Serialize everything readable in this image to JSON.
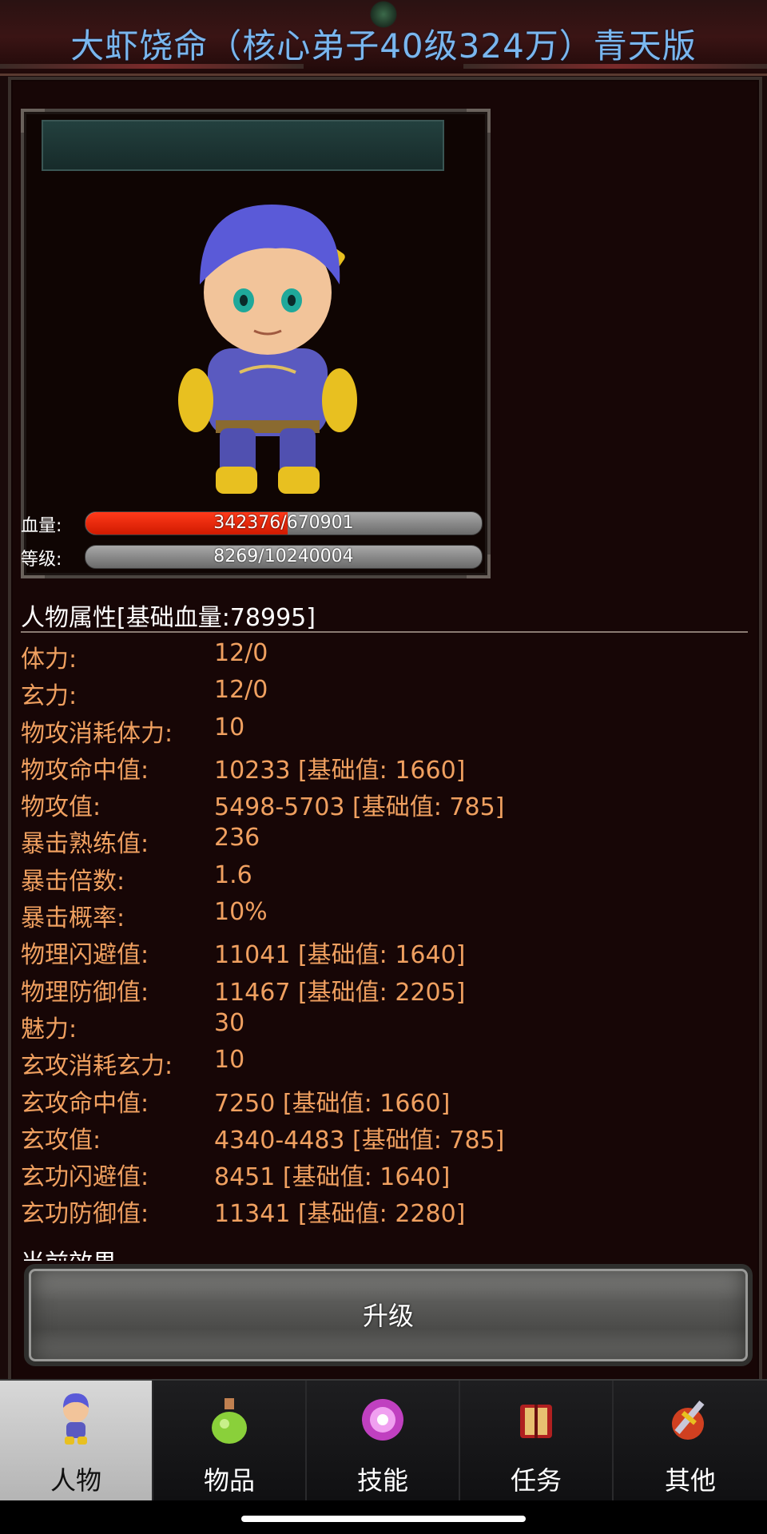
{
  "header": {
    "title": "大虾饶命（核心弟子40级324万）青天版"
  },
  "stats": {
    "hp": {
      "label": "血量:",
      "current": 342376,
      "max": 670901,
      "text": "342376/670901",
      "color": "#e8240a"
    },
    "level": {
      "label": "等级:",
      "current": 8269,
      "max": 10240004,
      "text": "8269/10240004"
    }
  },
  "attributes": {
    "title": "人物属性[基础血量:78995]",
    "rows": [
      {
        "label": "体力:",
        "value": "12/0"
      },
      {
        "label": "玄力:",
        "value": "12/0"
      },
      {
        "label": "物攻消耗体力:",
        "value": "10"
      },
      {
        "label": "物攻命中值:",
        "value": "10233 [基础值: 1660]"
      },
      {
        "label": "物攻值:",
        "value": "5498-5703 [基础值: 785]"
      },
      {
        "label": "暴击熟练值:",
        "value": "236"
      },
      {
        "label": "暴击倍数:",
        "value": "1.6"
      },
      {
        "label": "暴击概率:",
        "value": "10%"
      },
      {
        "label": "物理闪避值:",
        "value": "11041 [基础值: 1640]"
      },
      {
        "label": "物理防御值:",
        "value": "11467 [基础值: 2205]"
      },
      {
        "label": "魅力:",
        "value": "30"
      },
      {
        "label": "玄攻消耗玄力:",
        "value": "10"
      },
      {
        "label": "玄攻命中值:",
        "value": "7250 [基础值: 1660]"
      },
      {
        "label": "玄攻值:",
        "value": "4340-4483 [基础值: 785]"
      },
      {
        "label": "玄功闪避值:",
        "value": "8451 [基础值: 1640]"
      },
      {
        "label": "玄功防御值:",
        "value": "11341 [基础值: 2280]"
      }
    ],
    "cutoff_text": "当前效果"
  },
  "upgrade_button": {
    "label": "升级"
  },
  "nav": {
    "tabs": [
      {
        "label": "人物",
        "icon": "character-icon",
        "active": true
      },
      {
        "label": "物品",
        "icon": "potion-icon",
        "active": false
      },
      {
        "label": "技能",
        "icon": "skill-orb-icon",
        "active": false
      },
      {
        "label": "任务",
        "icon": "quest-book-icon",
        "active": false
      },
      {
        "label": "其他",
        "icon": "settings-sword-icon",
        "active": false
      }
    ]
  },
  "colors": {
    "title_blue": "#7ab6ee",
    "attr_orange": "#f0a060",
    "hp_red": "#e8240a",
    "background": "#170606"
  }
}
